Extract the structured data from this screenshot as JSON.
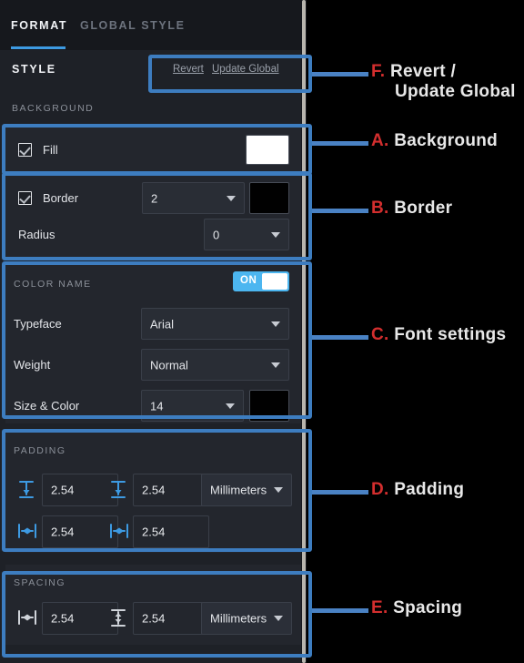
{
  "panel": {
    "tabs": [
      {
        "label": "FORMAT",
        "active": true
      },
      {
        "label": "GLOBAL STYLE",
        "active": false
      }
    ],
    "style_section": {
      "title": "STYLE",
      "revert_label": "Revert",
      "update_global_label": "Update Global"
    },
    "background": {
      "header": "BACKGROUND",
      "fill_label": "Fill",
      "fill_checked": true,
      "fill_color": "#ffffff",
      "border_label": "Border",
      "border_checked": true,
      "border_width": "2",
      "border_color": "#010101",
      "radius_label": "Radius",
      "radius_value": "0"
    },
    "color_name": {
      "header": "COLOR NAME",
      "toggle_state": "ON",
      "typeface_label": "Typeface",
      "typeface_value": "Arial",
      "weight_label": "Weight",
      "weight_value": "Normal",
      "size_color_label": "Size & Color",
      "size_value": "14",
      "text_color": "#010101"
    },
    "padding": {
      "header": "PADDING",
      "top_value": "2.54",
      "bottom_value": "2.54",
      "left_value": "2.54",
      "right_value": "2.54",
      "units_value": "Millimeters"
    },
    "spacing": {
      "header": "SPACING",
      "horizontal_value": "2.54",
      "vertical_value": "2.54",
      "units_value": "Millimeters"
    }
  },
  "annotations": [
    {
      "letter": "F.",
      "text": "Revert /",
      "text2": "Update Global"
    },
    {
      "letter": "A.",
      "text": "Background"
    },
    {
      "letter": "B.",
      "text": "Border"
    },
    {
      "letter": "C.",
      "text": "Font settings"
    },
    {
      "letter": "D.",
      "text": "Padding"
    },
    {
      "letter": "E.",
      "text": "Spacing"
    }
  ],
  "colors": {
    "accent_blue": "#3d9ae2",
    "callout_blue": "#3d7dc0",
    "annotation_red": "#d32e2e",
    "panel_bg": "#1e2127",
    "card_bg": "#23262d",
    "icon_teal": "#3d9ae2"
  }
}
